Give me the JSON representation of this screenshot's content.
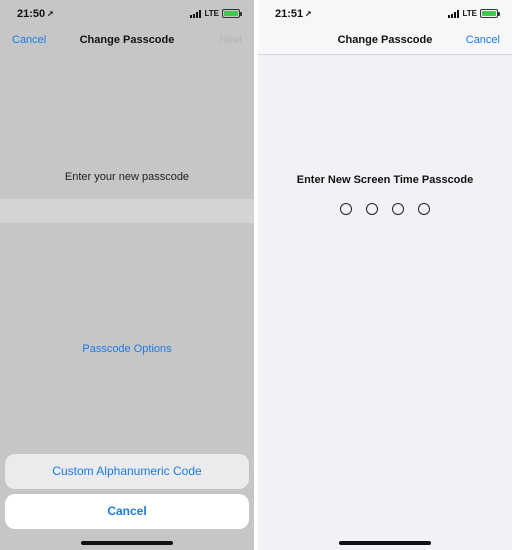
{
  "left_screen": {
    "status": {
      "time": "21:50",
      "network": "LTE",
      "location_icon": "location-arrow-icon"
    },
    "nav": {
      "cancel_label": "Cancel",
      "title": "Change Passcode",
      "next_label": "Next"
    },
    "prompt": "Enter your new passcode",
    "options_link": "Passcode Options",
    "action_sheet": {
      "option_label": "Custom Alphanumeric Code",
      "cancel_label": "Cancel"
    }
  },
  "right_screen": {
    "status": {
      "time": "21:51",
      "network": "LTE",
      "location_icon": "location-arrow-icon"
    },
    "nav": {
      "title": "Change Passcode",
      "cancel_label": "Cancel"
    },
    "prompt": "Enter New Screen Time Passcode",
    "passcode_digits": 4,
    "digits_entered": 0
  },
  "colors": {
    "accent": "#1a7be3",
    "disabled": "#b3b3b6",
    "battery": "#3cc94e",
    "dimmed_background": "#c6c6c8",
    "background": "#f2f2f6"
  }
}
